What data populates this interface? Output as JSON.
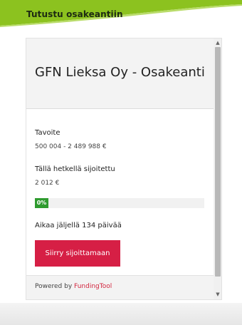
{
  "banner": {
    "title": "Tutustu osakeantiin",
    "accent_color": "#8cc21f"
  },
  "widget": {
    "title": "GFN Lieksa Oy - Osakeanti",
    "target_label": "Tavoite",
    "target_value": "500 004 - 2 489 988 €",
    "invested_label": "Tällä hetkellä sijoitettu",
    "invested_value": "2 012 €",
    "progress_text": "0%",
    "progress_fraction": 0.0,
    "time_left": "Aikaa jäljellä 134 päivää",
    "cta_label": "Siirry sijoittamaan",
    "cta_color": "#d61f45"
  },
  "footer": {
    "powered_by": "Powered by",
    "brand": "FundingTool"
  }
}
